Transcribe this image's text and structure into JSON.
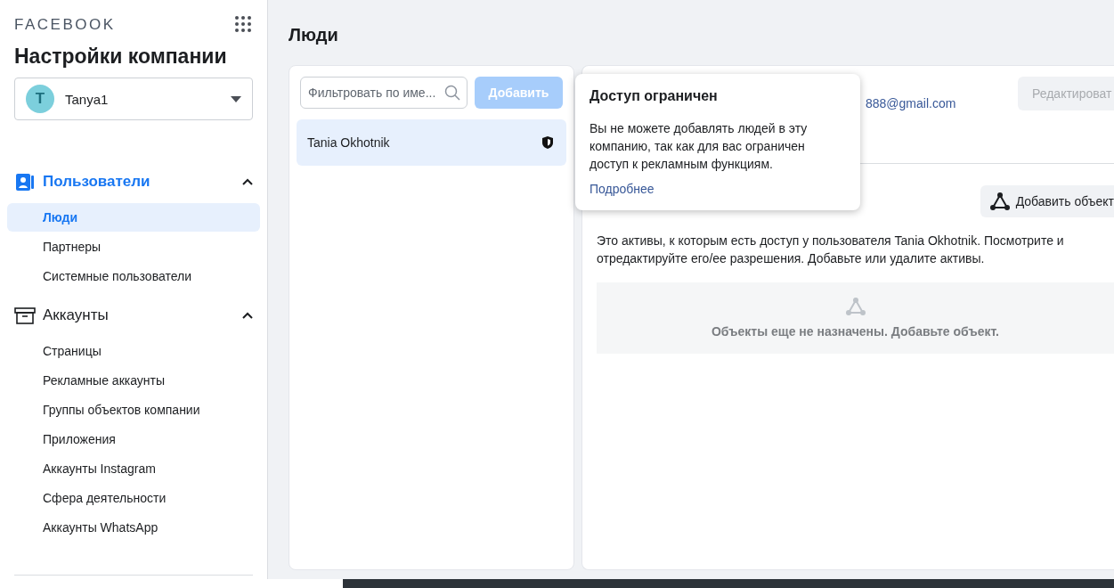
{
  "brand": "FACEBOOK",
  "title": "Настройки компании",
  "account": {
    "initial": "T",
    "name": "Tanya1"
  },
  "nav": [
    {
      "kind": "users",
      "label": "Пользователи",
      "selected": true,
      "expanded": true,
      "items": [
        {
          "label": "Люди",
          "selected": true
        },
        {
          "label": "Партнеры",
          "selected": false
        },
        {
          "label": "Системные пользователи",
          "selected": false
        }
      ]
    },
    {
      "kind": "accounts",
      "label": "Аккаунты",
      "selected": false,
      "expanded": true,
      "items": [
        {
          "label": "Страницы",
          "selected": false
        },
        {
          "label": "Рекламные аккаунты",
          "selected": false
        },
        {
          "label": "Группы объектов компании",
          "selected": false
        },
        {
          "label": "Приложения",
          "selected": false
        },
        {
          "label": "Аккаунты Instagram",
          "selected": false
        },
        {
          "label": "Сфера деятельности",
          "selected": false
        },
        {
          "label": "Аккаунты WhatsApp",
          "selected": false
        }
      ]
    }
  ],
  "page_title": "Люди",
  "people": {
    "search": {
      "placeholder": "Фильтровать по име..."
    },
    "add_button": {
      "label": "Добавить",
      "disabled": true
    },
    "rows": [
      {
        "name": "Tania Okhotnik",
        "selected": true
      }
    ]
  },
  "detail": {
    "email": "888@gmail.com",
    "edit_button": {
      "label": "Редактироват",
      "disabled": true
    },
    "add_assets_button": "Добавить объект",
    "description": "Это активы, к которым есть доступ у пользователя Tania Okhotnik. Посмотрите и отредактируйте его/ее разрешения. Добавьте или удалите активы.",
    "empty_text": "Объекты еще не назначены. Добавьте объект."
  },
  "popover": {
    "title": "Доступ ограничен",
    "body": "Вы не можете добавлять людей в эту компанию, так как для вас ограничен доступ к рекламным функциям.",
    "link": "Подробнее"
  }
}
